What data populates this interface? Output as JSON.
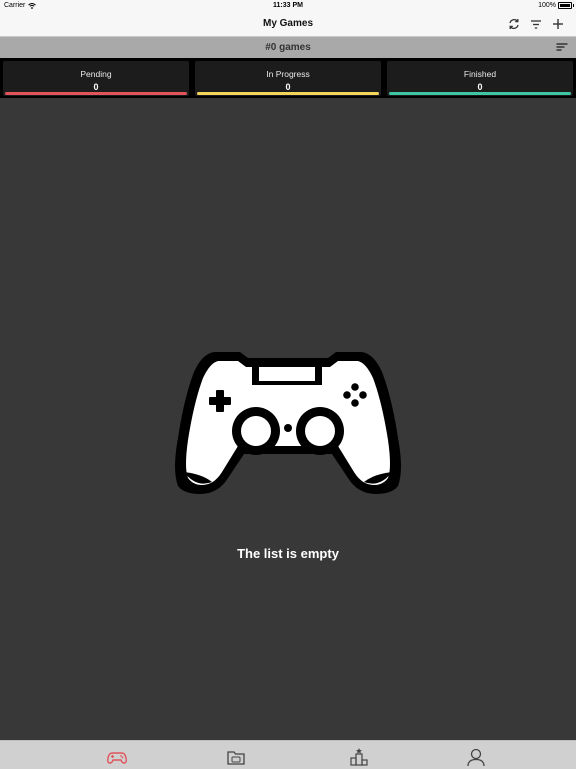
{
  "status_bar": {
    "carrier": "Carrier",
    "time": "11:33 PM",
    "battery": "100%"
  },
  "nav": {
    "title": "My Games",
    "icons": [
      "refresh-icon",
      "filter-icon",
      "add-icon"
    ]
  },
  "count_bar": {
    "label": "#0 games",
    "icon": "sort-icon"
  },
  "stats": [
    {
      "label": "Pending",
      "value": "0",
      "color": "#e0545c"
    },
    {
      "label": "In Progress",
      "value": "0",
      "color": "#f3d55b"
    },
    {
      "label": "Finished",
      "value": "0",
      "color": "#3fc7a4"
    }
  ],
  "empty_state": {
    "icon": "gamepad-icon",
    "text": "The list is empty"
  },
  "tabs": [
    {
      "icon": "gamepad-icon",
      "active": true,
      "color": "#e0545c"
    },
    {
      "icon": "folder-icon",
      "active": false
    },
    {
      "icon": "ranking-icon",
      "active": false
    },
    {
      "icon": "profile-icon",
      "active": false
    }
  ]
}
